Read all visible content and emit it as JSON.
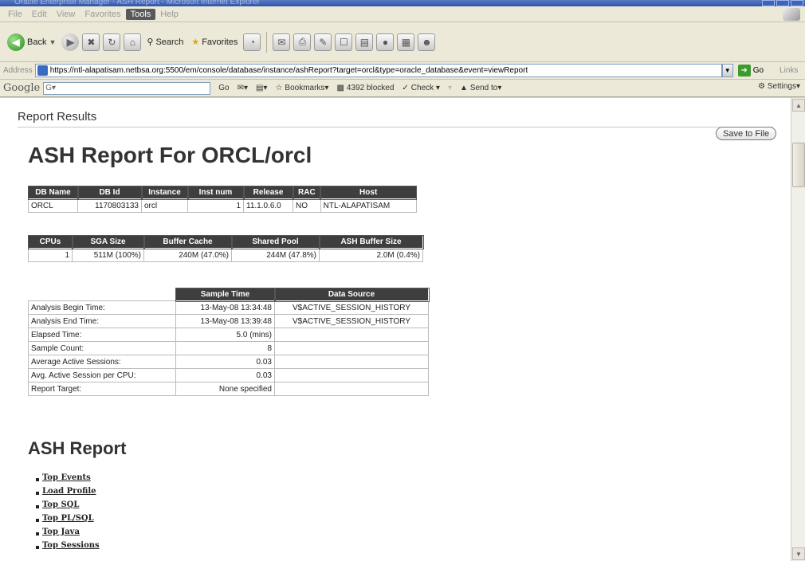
{
  "window": {
    "title": "Oracle Enterprise Manager - ASH Report - Microsoft Internet Explorer"
  },
  "menu": {
    "items": [
      "File",
      "Edit",
      "View",
      "Favorites",
      "Tools",
      "Help"
    ],
    "active": "Tools"
  },
  "toolbar": {
    "back_label": "Back",
    "search_label": "Search",
    "favorites_label": "Favorites"
  },
  "address": {
    "label": "Address",
    "url": "https://ntl-alapatisam.netbsa.org:5500/em/console/database/instance/ashReport?target=orcl&type=oracle_database&event=viewReport",
    "go_label": "Go",
    "links_label": "Links"
  },
  "google_bar": {
    "logo": "Google",
    "query": "G▾",
    "go": "Go",
    "bookmarks": "Bookmarks▾",
    "blocked": "4392 blocked",
    "check": "Check ▾",
    "send_to": "Send to▾",
    "settings": "Settings▾"
  },
  "page": {
    "header": "Report Results",
    "save_button": "Save to File",
    "title": "ASH Report For ORCL/orcl",
    "section_title": "ASH Report"
  },
  "db_table": {
    "headers": [
      "DB Name",
      "DB Id",
      "Instance",
      "Inst num",
      "Release",
      "RAC",
      "Host"
    ],
    "row": [
      "ORCL",
      "1170803133",
      "orcl",
      "1",
      "11.1.0.6.0",
      "NO",
      "NTL-ALAPATISAM"
    ]
  },
  "mem_table": {
    "headers": [
      "CPUs",
      "SGA Size",
      "Buffer Cache",
      "Shared Pool",
      "ASH Buffer Size"
    ],
    "row": [
      "1",
      "511M (100%)",
      "240M (47.0%)",
      "244M (47.8%)",
      "2.0M (0.4%)"
    ]
  },
  "time_table": {
    "headers": [
      "",
      "Sample Time",
      "Data Source"
    ],
    "rows": [
      [
        "Analysis Begin Time:",
        "13-May-08 13:34:48",
        "V$ACTIVE_SESSION_HISTORY"
      ],
      [
        "Analysis End Time:",
        "13-May-08 13:39:48",
        "V$ACTIVE_SESSION_HISTORY"
      ],
      [
        "Elapsed Time:",
        "5.0 (mins)",
        ""
      ],
      [
        "Sample Count:",
        "8",
        ""
      ],
      [
        "Average Active Sessions:",
        "0.03",
        ""
      ],
      [
        "Avg. Active Session per CPU:",
        "0.03",
        ""
      ],
      [
        "Report Target:",
        "None specified",
        ""
      ]
    ]
  },
  "report_links": [
    "Top Events",
    "Load Profile",
    "Top SQL",
    "Top PL/SQL",
    "Top Java",
    "Top Sessions"
  ]
}
